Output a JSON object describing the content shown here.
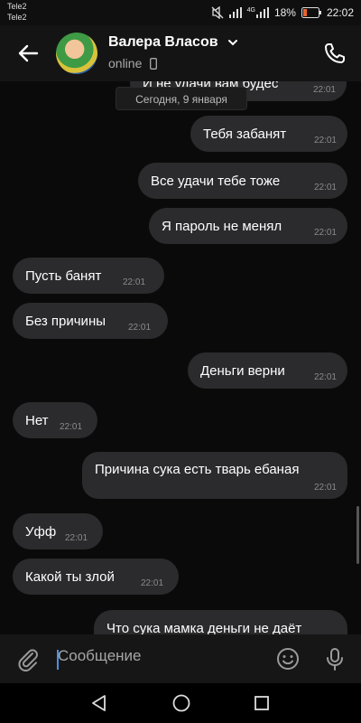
{
  "status_bar": {
    "carrier_1": "Tele2",
    "carrier_2": "Tele2",
    "network": "4G",
    "battery": "18%",
    "time": "22:02"
  },
  "header": {
    "contact_name": "Валера Власов",
    "status": "online"
  },
  "chat": {
    "date_pill": "Сегодня, 9 января",
    "messages": [
      {
        "text": "И не удачи вам будес",
        "time": "22:01",
        "side": "right"
      },
      {
        "text": "Тебя забанят",
        "time": "22:01",
        "side": "right"
      },
      {
        "text": "Все удачи тебе тоже",
        "time": "22:01",
        "side": "right"
      },
      {
        "text": "Я пароль не менял",
        "time": "22:01",
        "side": "right"
      },
      {
        "text": "Пусть банят",
        "time": "22:01",
        "side": "left"
      },
      {
        "text": "Без причины",
        "time": "22:01",
        "side": "left"
      },
      {
        "text": "Деньги верни",
        "time": "22:01",
        "side": "right"
      },
      {
        "text": "Нет",
        "time": "22:01",
        "side": "left"
      },
      {
        "text": "Причина сука есть тварь ебаная",
        "time": "22:01",
        "side": "right"
      },
      {
        "text": "Уфф",
        "time": "22:01",
        "side": "left"
      },
      {
        "text": "Какой ты злой",
        "time": "22:01",
        "side": "left"
      },
      {
        "text": "Что сука мамка деньги не даёт",
        "time": "",
        "side": "right"
      }
    ]
  },
  "composer": {
    "placeholder": "Сообщение"
  },
  "icons": {
    "back": "arrow-left-icon",
    "call": "phone-icon",
    "attach": "paperclip-icon",
    "emoji": "smile-icon",
    "voice": "mic-icon"
  }
}
